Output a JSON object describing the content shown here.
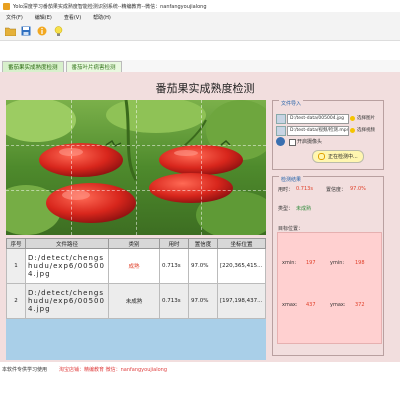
{
  "window": {
    "title": "Yolo深度学习番茄果实成熟度智能检测识别系统--精编教育--微信：nanfangyoujialong"
  },
  "menu": [
    "文件(F)",
    "编辑(E)",
    "查看(V)",
    "帮助(H)"
  ],
  "toolbar": {
    "icons": [
      "folder-icon",
      "save-icon",
      "info-icon",
      "bulb-icon"
    ]
  },
  "tabs": [
    {
      "label": "番茄果实成熟度检测",
      "active": true
    },
    {
      "label": "番茄叶片病害检测",
      "active": false
    }
  ],
  "main": {
    "heading": "番茄果实成熟度检测"
  },
  "file_import": {
    "title": "文件导入",
    "image_path": "D:/test-data/005004.jpg",
    "video_path": "D:/test-data/视频/检测.mp4",
    "select_image_label": "选择图片",
    "select_video_label": "选择视频",
    "camera_label": "开启摄像头",
    "run_label": "正在检测中..."
  },
  "results": {
    "title": "检测结果",
    "time_label": "用时：",
    "time_value": "0.713s",
    "conf_label": "置信度：",
    "conf_value": "97.0%",
    "type_label": "类型：",
    "type_value": "未成熟",
    "target_label": "目标位置：",
    "xmin_label": "xmin:",
    "xmin_value": "197",
    "ymin_label": "ymin:",
    "ymin_value": "198",
    "xmax_label": "xmax:",
    "xmax_value": "437",
    "ymax_label": "ymax:",
    "ymax_value": "372"
  },
  "table": {
    "headers": [
      "序号",
      "文件路径",
      "类别",
      "用时",
      "置信度",
      "坐标位置"
    ],
    "rows": [
      {
        "index": "1",
        "path": "D:/detect/chengshudu/exp6/005004.jpg",
        "cls": "成熟",
        "time": "0.713s",
        "conf": "97.0%",
        "pos": "[220,365,415..."
      },
      {
        "index": "2",
        "path": "D:/detect/chengshudu/exp6/005004.jpg",
        "cls": "未成熟",
        "time": "0.713s",
        "conf": "97.0%",
        "pos": "[197,198,437..."
      }
    ]
  },
  "status": {
    "left": "本软件专供学习使用",
    "right": "淘宝店铺：精编教育  微信：nanfangyoujialong"
  },
  "colors": {
    "pane_bg": "#f2dede",
    "accent_blue": "#1d5ea8",
    "ripe_red": "#e0402a",
    "unripe_green": "#2f8a3a",
    "table_fill": "#a9cfe8"
  }
}
